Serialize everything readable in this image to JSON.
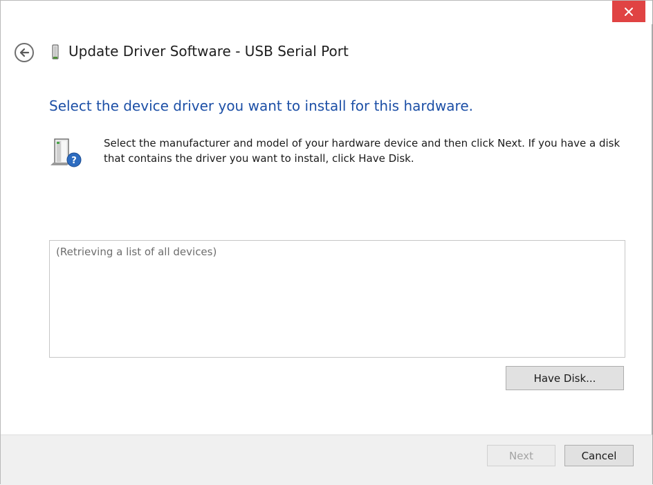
{
  "window": {
    "title": "Update Driver Software - USB Serial Port"
  },
  "titlebar": {
    "close_icon": "close-x-icon",
    "close_color": "#e04343"
  },
  "header": {
    "back_icon": "back-arrow-circle-icon",
    "device_icon": "usb-device-icon"
  },
  "main": {
    "heading": "Select the device driver you want to install for this hardware.",
    "heading_color": "#1c4fa6",
    "hardware_icon": "hardware-question-icon",
    "instructions": "Select the manufacturer and model of your hardware device and then click Next. If you have a disk that contains the driver you want to install, click Have Disk.",
    "device_list": {
      "status_text": "(Retrieving a list of all devices)"
    },
    "have_disk_label": "Have Disk..."
  },
  "footer": {
    "next_label": "Next",
    "next_enabled": false,
    "cancel_label": "Cancel"
  }
}
